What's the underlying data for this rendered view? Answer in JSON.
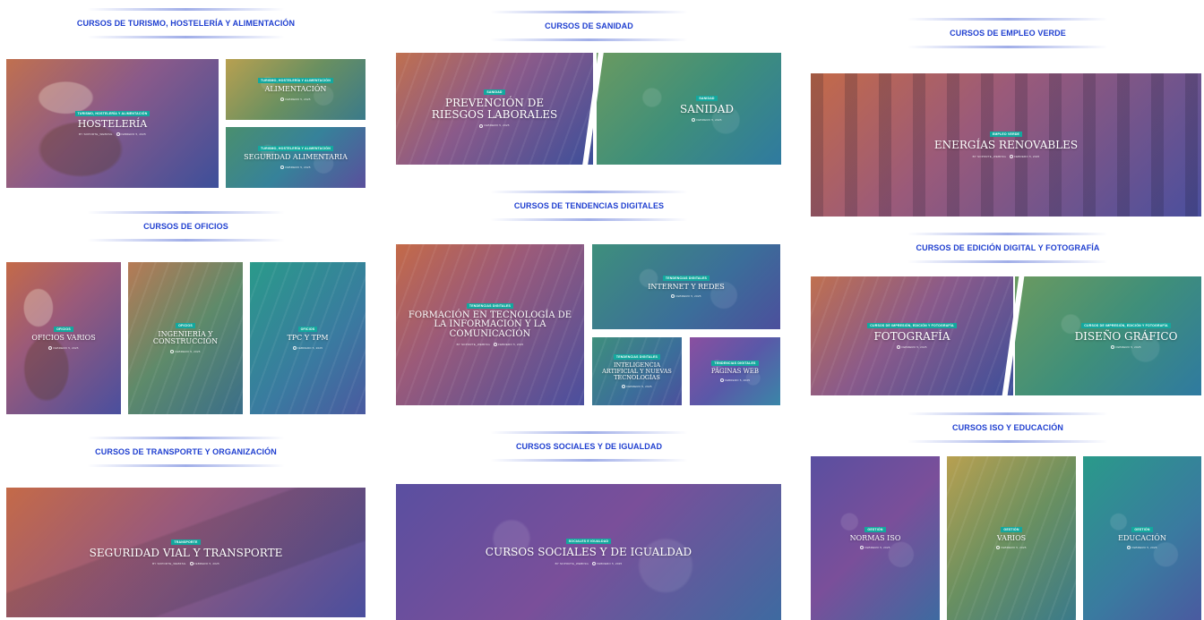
{
  "sections": {
    "turismo": "CURSOS DE TURISMO, HOSTELERÍA Y ALIMENTACIÓN",
    "oficios": "CURSOS DE OFICIOS",
    "transporte": "CURSOS DE TRANSPORTE Y ORGANIZACIÓN",
    "sanidad": "CURSOS DE SANIDAD",
    "digitales": "CURSOS DE TENDENCIAS DIGITALES",
    "sociales": "CURSOS SOCIALES Y DE IGUALDAD",
    "empleo_verde": "CURSOS DE EMPLEO VERDE",
    "edicion": "CURSOS DE EDICIÓN DIGITAL Y FOTOGRAFÍA",
    "iso": "CURSOS ISO Y EDUCACIÓN"
  },
  "cards": {
    "hosteleria": {
      "badge": "TURISMO, HOSTELERÍA Y ALIMENTACIÓN",
      "title": "HOSTELERÍA",
      "author": "BY SOPORTE_WEBFSG",
      "date": "FEBRERO 5, 2025"
    },
    "alimentacion": {
      "badge": "TURISMO, HOSTELERÍA Y ALIMENTACIÓN",
      "title": "ALIMENTACIÓN",
      "date": "FEBRERO 5, 2025"
    },
    "seguridad_alimentaria": {
      "badge": "TURISMO, HOSTELERÍA Y ALIMENTACIÓN",
      "title": "SEGURIDAD ALIMENTARIA",
      "date": "FEBRERO 5, 2025"
    },
    "oficios_varios": {
      "badge": "OFICIOS",
      "title": "OFICIOS VARIOS",
      "date": "FEBRERO 5, 2025"
    },
    "ingenieria": {
      "badge": "OFICIOS",
      "title": "INGENIERÍA Y CONSTRUCCIÓN",
      "date": "FEBRERO 5, 2025"
    },
    "tpc": {
      "badge": "OFICIOS",
      "title": "TPC Y TPM",
      "date": "FEBRERO 5, 2025"
    },
    "seguridad_vial": {
      "badge": "TRANSPORTE",
      "title": "SEGURIDAD VIAL Y TRANSPORTE",
      "author": "BY SOPORTE_WEBFSG",
      "date": "FEBRERO 5, 2025"
    },
    "prevencion": {
      "badge": "SANIDAD",
      "title": "PREVENCIÓN DE RIESGOS LABORALES",
      "date": "FEBRERO 5, 2025"
    },
    "sanidad": {
      "badge": "SANIDAD",
      "title": "SANIDAD",
      "date": "FEBRERO 5, 2025"
    },
    "formacion_tic": {
      "badge": "TENDENCIAS DIGITALES",
      "title": "FORMACIÓN EN TECNOLOGÍA DE LA INFORMACIÓN Y LA COMUNICACIÓN",
      "author": "BY SOPORTE_WEBFSG",
      "date": "FEBRERO 5, 2025"
    },
    "internet_redes": {
      "badge": "TENDENCIAS DIGITALES",
      "title": "INTERNET Y REDES",
      "date": "FEBRERO 5, 2025"
    },
    "inteligencia_artificial": {
      "badge": "TENDENCIAS DIGITALES",
      "title": "INTELIGENCIA ARTIFICIAL Y NUEVAS TECNOLOGÍAS",
      "date": "FEBRERO 5, 2025"
    },
    "paginas_web": {
      "badge": "TENDENCIAS DIGITALES",
      "title": "PÁGINAS WEB",
      "date": "FEBRERO 5, 2025"
    },
    "sociales": {
      "badge": "SOCIALES E IGUALDAD",
      "title": "CURSOS SOCIALES Y DE IGUALDAD",
      "author": "BY SOPORTE_WEBFSG",
      "date": "FEBRERO 5, 2025"
    },
    "energias": {
      "badge": "EMPLEO VERDE",
      "title": "ENERGÍAS RENOVABLES",
      "author": "BY SOPORTE_WEBFSG",
      "date": "FEBRERO 5, 2025"
    },
    "fotografia": {
      "badge": "CURSOS DE IMPRESIÓN, EDICIÓN Y FOTOGRAFÍA",
      "title": "FOTOGRAFÍA",
      "date": "FEBRERO 5, 2025"
    },
    "diseno": {
      "badge": "CURSOS DE IMPRESIÓN, EDICIÓN Y FOTOGRAFÍA",
      "title": "DISEÑO GRÁFICO",
      "date": "FEBRERO 5, 2025"
    },
    "normas_iso": {
      "badge": "GESTIÓN",
      "title": "NORMAS ISO",
      "date": "FEBRERO 5, 2025"
    },
    "varios": {
      "badge": "GESTIÓN",
      "title": "VARIOS",
      "date": "FEBRERO 5, 2025"
    },
    "educacion": {
      "badge": "GESTIÓN",
      "title": "EDUCACIÓN",
      "date": "FEBRERO 5, 2025"
    }
  },
  "colors": {
    "heading": "#1f3fd0",
    "badge": "#13a89e"
  }
}
